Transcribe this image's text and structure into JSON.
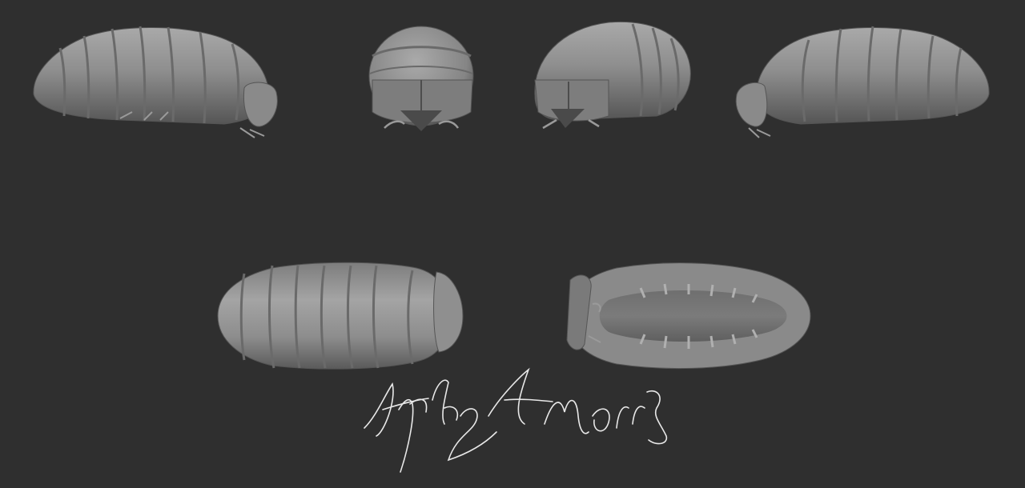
{
  "scene": {
    "background": "#2f2f2f",
    "model_color": "#8c8c8c",
    "highlight_color": "#b5b5b5",
    "shadow_color": "#4a4a4a",
    "signature_color": "#e8e8e8",
    "views": [
      {
        "view": "side-left"
      },
      {
        "view": "front"
      },
      {
        "view": "front-three-quarter"
      },
      {
        "view": "side-right"
      },
      {
        "view": "top"
      },
      {
        "view": "bottom"
      }
    ],
    "signature": {
      "text": "Amythyst Morris"
    }
  }
}
